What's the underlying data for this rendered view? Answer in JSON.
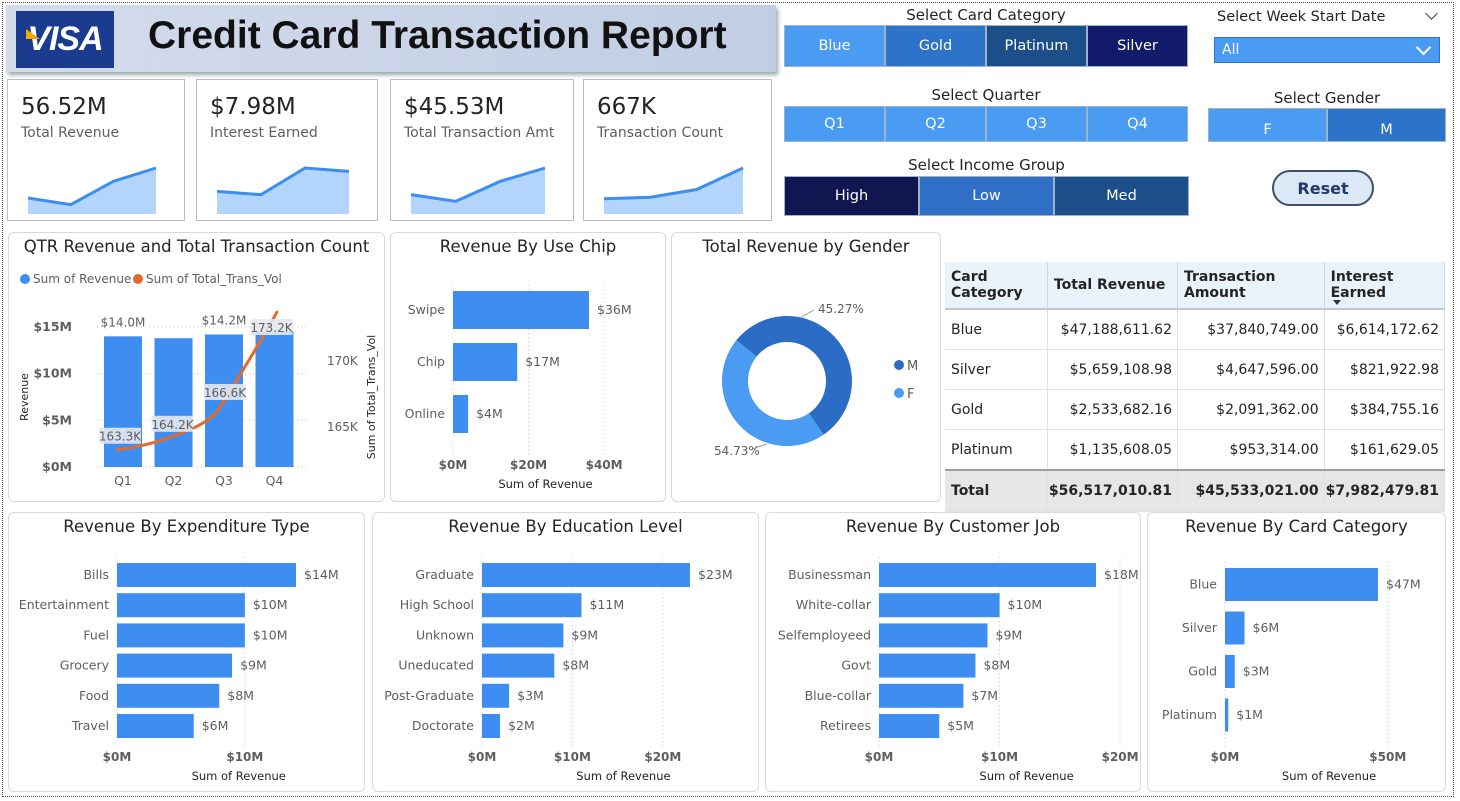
{
  "header": {
    "logo_text": "VISA",
    "title": "Credit Card Transaction Report"
  },
  "kpis": [
    {
      "value": "56.52M",
      "label": "Total Revenue",
      "trend": [
        3,
        1,
        8,
        12
      ]
    },
    {
      "value": "$7.98M",
      "label": "Interest Earned",
      "trend": [
        5,
        4,
        12,
        11
      ]
    },
    {
      "value": "$45.53M",
      "label": "Total Transaction Amt",
      "trend": [
        4,
        2,
        8,
        12
      ]
    },
    {
      "value": "667K",
      "label": "Transaction Count",
      "trend": [
        3,
        3.5,
        6,
        13
      ]
    }
  ],
  "slicers": {
    "card_category": {
      "title": "Select Card Category",
      "options": [
        "Blue",
        "Gold",
        "Platinum",
        "Silver"
      ],
      "colors": [
        "#4a9bf2",
        "#2d73c9",
        "#1c4f8a",
        "#121b6b"
      ]
    },
    "week_start": {
      "title": "Select Week Start Date",
      "value": "All"
    },
    "quarter": {
      "title": "Select Quarter",
      "options": [
        "Q1",
        "Q2",
        "Q3",
        "Q4"
      ]
    },
    "gender": {
      "title": "Select Gender",
      "options": [
        "F",
        "M"
      ],
      "colors": [
        "#4a9bf2",
        "#2d73c9"
      ]
    },
    "income_group": {
      "title": "Select Income Group",
      "options": [
        "High",
        "Low",
        "Med"
      ],
      "colors": [
        "#121650",
        "#2f70c6",
        "#1c4f8a"
      ]
    },
    "reset_label": "Reset"
  },
  "chart_data": [
    {
      "id": "qtr",
      "type": "bar",
      "title": "QTR Revenue and Total Transaction Count",
      "categories": [
        "Q1",
        "Q2",
        "Q3",
        "Q4"
      ],
      "legend": [
        "Sum of Revenue",
        "Sum of Total_Trans_Vol"
      ],
      "series": [
        {
          "name": "Sum of Revenue",
          "values": [
            14.0,
            13.8,
            14.2,
            14.5
          ],
          "labels": [
            "$14.0M",
            "",
            "$14.2M",
            ""
          ],
          "color": "#3d8ef0"
        },
        {
          "name": "Sum of Total_Trans_Vol",
          "type": "line",
          "values": [
            163.3,
            164.2,
            166.6,
            173.2
          ],
          "labels": [
            "163.3K",
            "164.2K",
            "166.6K",
            "173.2K"
          ],
          "color": "#e06b2d"
        }
      ],
      "ylabel": "Revenue",
      "y2label": "Sum of Total_Trans_Vol",
      "yticks": [
        "$0M",
        "$5M",
        "$10M",
        "$15M"
      ],
      "y2ticks": [
        "165K",
        "170K"
      ],
      "ylim": [
        0,
        15
      ],
      "y2lim": [
        162,
        173
      ]
    },
    {
      "id": "chip",
      "type": "bar",
      "orientation": "horizontal",
      "title": "Revenue By Use Chip",
      "categories": [
        "Swipe",
        "Chip",
        "Online"
      ],
      "values": [
        36,
        17,
        4
      ],
      "labels": [
        "$36M",
        "$17M",
        "$4M"
      ],
      "xticks": [
        "$0M",
        "$20M",
        "$40M"
      ],
      "xlim": [
        0,
        40
      ],
      "xlabel": "Sum of Revenue"
    },
    {
      "id": "gender",
      "type": "pie",
      "title": "Total Revenue by Gender",
      "categories": [
        "M",
        "F"
      ],
      "values": [
        54.73,
        45.27
      ],
      "labels": [
        "54.73%",
        "45.27%"
      ],
      "colors": [
        "#2b6cc4",
        "#4a9bf2"
      ]
    },
    {
      "id": "expenditure",
      "type": "bar",
      "orientation": "horizontal",
      "title": "Revenue By Expenditure Type",
      "categories": [
        "Bills",
        "Entertainment",
        "Fuel",
        "Grocery",
        "Food",
        "Travel"
      ],
      "values": [
        14,
        10,
        10,
        9,
        8,
        6
      ],
      "labels": [
        "$14M",
        "$10M",
        "$10M",
        "$9M",
        "$8M",
        "$6M"
      ],
      "xticks": [
        "$0M",
        "$10M"
      ],
      "xlim": [
        0,
        14.5
      ],
      "xlabel": "Sum of Revenue"
    },
    {
      "id": "education",
      "type": "bar",
      "orientation": "horizontal",
      "title": "Revenue By Education Level",
      "categories": [
        "Graduate",
        "High School",
        "Unknown",
        "Uneducated",
        "Post-Graduate",
        "Doctorate"
      ],
      "values": [
        23,
        11,
        9,
        8,
        3,
        2
      ],
      "labels": [
        "$23M",
        "$11M",
        "$9M",
        "$8M",
        "$3M",
        "$2M"
      ],
      "xticks": [
        "$0M",
        "$10M",
        "$20M"
      ],
      "xlim": [
        0,
        25
      ],
      "xlabel": "Sum of Revenue"
    },
    {
      "id": "job",
      "type": "bar",
      "orientation": "horizontal",
      "title": "Revenue By Customer Job",
      "categories": [
        "Businessman",
        "White-collar",
        "Selfemployeed",
        "Govt",
        "Blue-collar",
        "Retirees"
      ],
      "values": [
        18,
        10,
        9,
        8,
        7,
        5
      ],
      "labels": [
        "$18M",
        "$10M",
        "$9M",
        "$8M",
        "$7M",
        "$5M"
      ],
      "xticks": [
        "$0M",
        "$10M",
        "$20M"
      ],
      "xlim": [
        0,
        21
      ],
      "xlabel": "Sum of Revenue"
    },
    {
      "id": "cardcat",
      "type": "bar",
      "orientation": "horizontal",
      "title": "Revenue By Card Category",
      "categories": [
        "Blue",
        "Silver",
        "Gold",
        "Platinum"
      ],
      "values": [
        47,
        6,
        3,
        1
      ],
      "labels": [
        "$47M",
        "$6M",
        "$3M",
        "$1M"
      ],
      "xticks": [
        "$0M",
        "$50M"
      ],
      "xlim": [
        0,
        50
      ],
      "xlabel": "Sum of Revenue"
    }
  ],
  "matrix": {
    "headers": [
      "Card Category",
      "Total Revenue",
      "Transaction Amount",
      "Interest Earned"
    ],
    "rows": [
      [
        "Blue",
        "$47,188,611.62",
        "$37,840,749.00",
        "$6,614,172.62"
      ],
      [
        "Silver",
        "$5,659,108.98",
        "$4,647,596.00",
        "$821,922.98"
      ],
      [
        "Gold",
        "$2,533,682.16",
        "$2,091,362.00",
        "$384,755.16"
      ],
      [
        "Platinum",
        "$1,135,608.05",
        "$953,314.00",
        "$161,629.05"
      ]
    ],
    "total": [
      "Total",
      "$56,517,010.81",
      "$45,533,021.00",
      "$7,982,479.81"
    ]
  }
}
